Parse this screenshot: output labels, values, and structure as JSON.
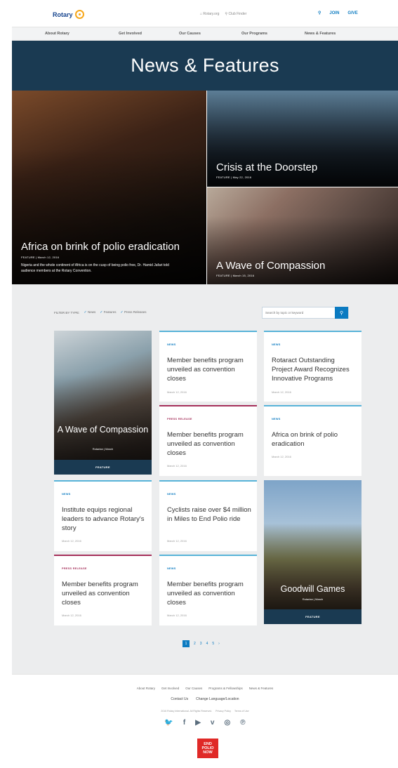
{
  "header": {
    "logo_text": "Rotary",
    "util_links": [
      "Rotary.org",
      "Club Finder"
    ],
    "search_icon": "search-icon",
    "join_label": "JOIN",
    "give_label": "GIVE"
  },
  "nav": [
    "About Rotary",
    "Get Involved",
    "Our Causes",
    "Our Programs",
    "News & Features"
  ],
  "hero": {
    "title": "News & Features"
  },
  "features": [
    {
      "title": "Africa on brink of polio eradication",
      "meta": "FEATURE  |  March 12, 2016",
      "desc": "Nigeria and the whole continent of Africa is on the cusp of being polio free, Dr. Hamid Jafari told audience members at the Rotary Convention."
    },
    {
      "title": "Crisis at the Doorstep",
      "meta": "FEATURE  |  May 22, 2016"
    },
    {
      "title": "A Wave of Compassion",
      "meta": "FEATURE  |  March 15, 2016"
    }
  ],
  "filter": {
    "label": "FILTER BY TYPE:",
    "options": [
      "News",
      "Features",
      "Press Releases"
    ],
    "search_placeholder": "Search by topic or keyword"
  },
  "big_cards": [
    {
      "title": "A Wave of Compassion",
      "meta": "Rotarian  |  March",
      "bar": "FEATURE"
    },
    {
      "title": "Goodwill Games",
      "meta": "Rotarian  |  March",
      "bar": "FEATURE"
    }
  ],
  "cards": [
    {
      "tag": "NEWS",
      "title": "Member benefits program unveiled as convention closes",
      "date": "March 12, 2016"
    },
    {
      "tag": "NEWS",
      "title": "Rotaract Outstanding Project Award Recognizes Innovative Programs",
      "date": "March 12, 2016"
    },
    {
      "tag": "PRESS RELEASE",
      "title": "Member benefits program unveiled as convention closes",
      "date": "March 12, 2016"
    },
    {
      "tag": "NEWS",
      "title": "Africa on brink of polio eradication",
      "date": "March 12, 2016"
    },
    {
      "tag": "NEWS",
      "title": "Institute equips regional leaders to advance Rotary's story",
      "date": "March 12, 2016"
    },
    {
      "tag": "NEWS",
      "title": "Cyclists raise over $4 million in Miles to End Polio ride",
      "date": "March 12, 2016"
    },
    {
      "tag": "PRESS RELEASE",
      "title": "Member benefits program unveiled as convention closes",
      "date": "March 12, 2016"
    },
    {
      "tag": "NEWS",
      "title": "Member benefits program unveiled as convention closes",
      "date": "March 12, 2016"
    }
  ],
  "pagination": {
    "current": "1",
    "pages": [
      "2",
      "3",
      "4",
      "5"
    ],
    "next": "›"
  },
  "footer": {
    "links": [
      "About Rotary",
      "Get Involved",
      "Our Causes",
      "Programs & Fellowships",
      "News & Features"
    ],
    "links2": [
      "Contact Us",
      "Change Language/Location"
    ],
    "copyright": [
      "2016 Rotary International. All Rights Reserved.",
      "Privacy Policy",
      "Terms of Use"
    ],
    "social": [
      "twitter-icon",
      "facebook-icon",
      "youtube-icon",
      "vimeo-icon",
      "instagram-icon",
      "pinterest-icon"
    ],
    "social_glyphs": [
      "🐦",
      "f",
      "▶",
      "v",
      "◎",
      "℗"
    ],
    "badge": [
      "END",
      "POLIO",
      "NOW"
    ]
  }
}
